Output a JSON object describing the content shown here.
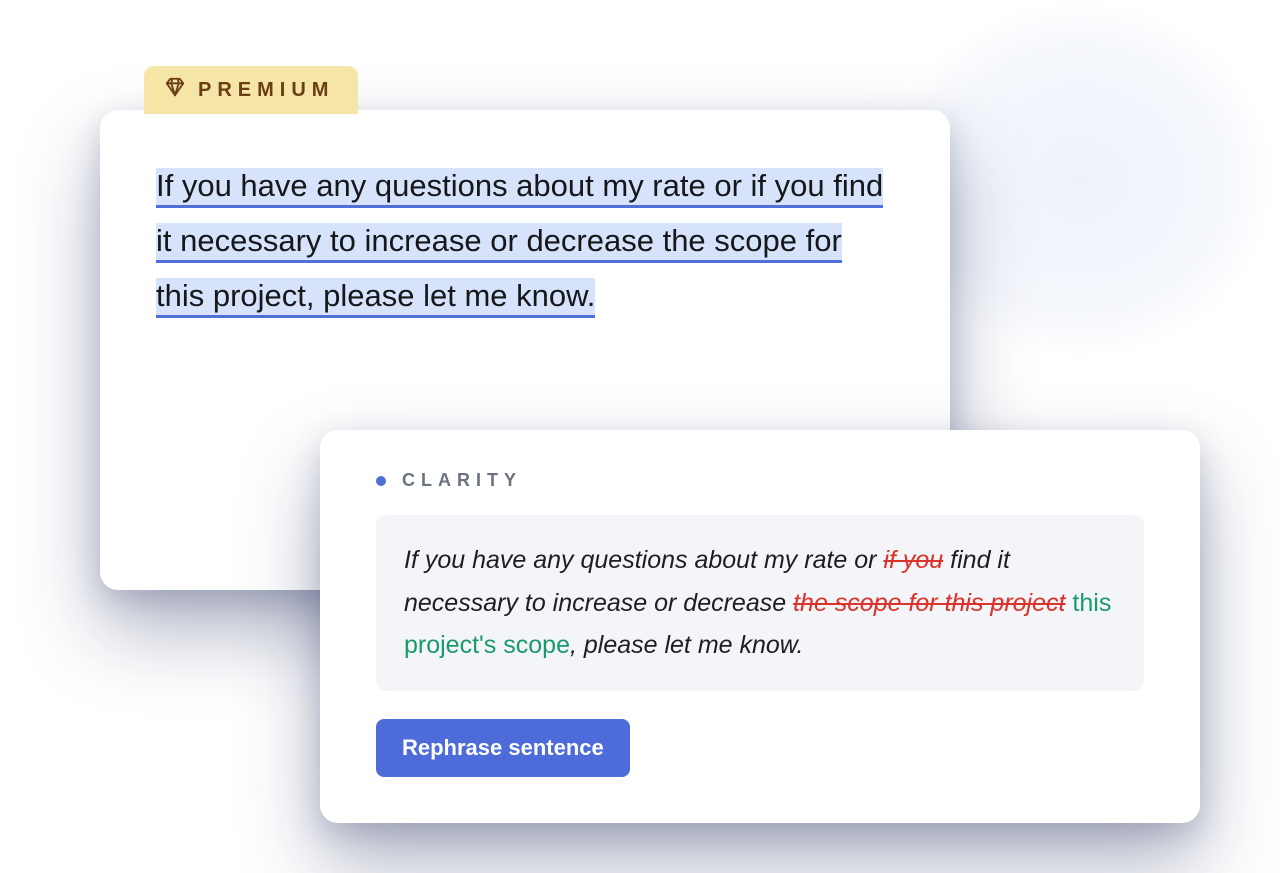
{
  "badge": {
    "label": "PREMIUM"
  },
  "editor": {
    "sentence": "If you have any questions about my rate or if you find it necessary to increase or decrease the scope for this project, please let me know."
  },
  "suggestion": {
    "category": "CLARITY",
    "segments": {
      "s1": "If you have any questions about my rate or ",
      "d1": "if you",
      "s2": " find it necessary to increase or decrease ",
      "d2": "the scope for this project",
      "s3": " ",
      "i1": "this project's scope",
      "s4": ", please let me know."
    },
    "action_label": "Rephrase sentence"
  },
  "colors": {
    "accent": "#4d6cd9",
    "delete": "#d9342b",
    "insert": "#1a9a6c",
    "badge_bg": "#f5e6a8",
    "highlight_bg": "#d7e3fb"
  }
}
